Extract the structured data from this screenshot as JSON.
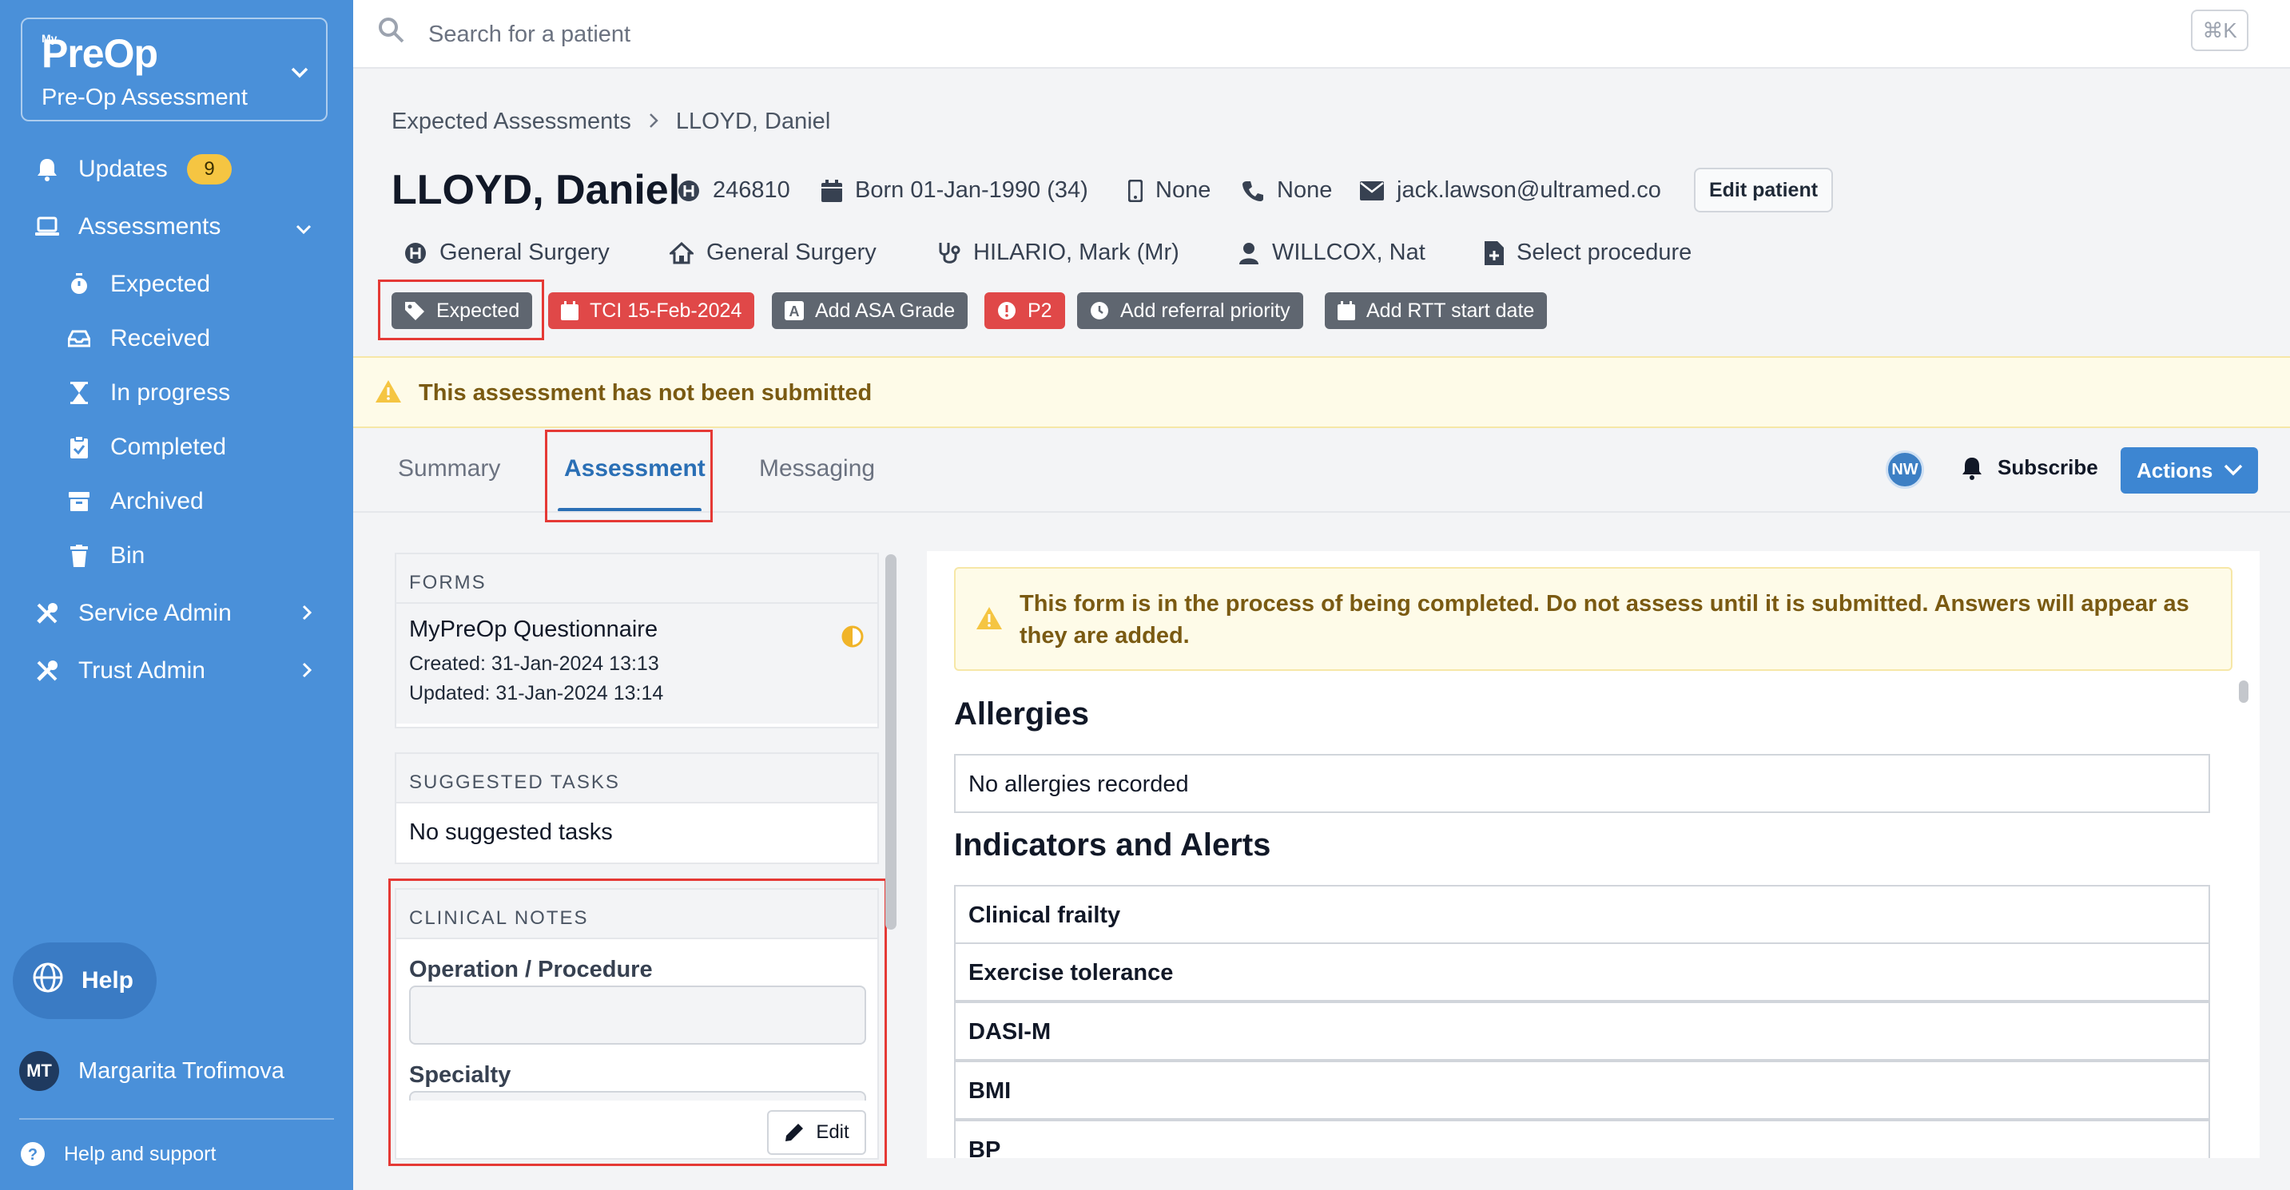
{
  "app": {
    "logo_sup": "My",
    "logo": "PreOp",
    "module": "Pre-Op Assessment"
  },
  "sidebar": {
    "updates_label": "Updates",
    "updates_count": "9",
    "assessments_label": "Assessments",
    "sub_items": [
      "Expected",
      "Received",
      "In progress",
      "Completed",
      "Archived",
      "Bin"
    ],
    "service_admin": "Service Admin",
    "trust_admin": "Trust Admin",
    "help": "Help",
    "user_initials": "MT",
    "user_name": "Margarita Trofimova",
    "support": "Help and support"
  },
  "search": {
    "placeholder": "Search for a patient",
    "shortcut": "⌘K"
  },
  "breadcrumb": {
    "parent": "Expected Assessments",
    "current": "LLOYD, Daniel"
  },
  "patient": {
    "name": "LLOYD, Daniel",
    "hospital_number": "246810",
    "born": "Born 01-Jan-1990 (34)",
    "mobile": "None",
    "phone": "None",
    "email": "jack.lawson@ultramed.co",
    "edit_label": "Edit patient",
    "specialty": "General Surgery",
    "department": "General Surgery",
    "consultant": "HILARIO, Mark (Mr)",
    "assignee": "WILLCOX, Nat",
    "procedure": "Select procedure"
  },
  "tags": {
    "status": "Expected",
    "tci": "TCI 15-Feb-2024",
    "asa": "Add ASA Grade",
    "priority": "P2",
    "referral": "Add referral priority",
    "rtt": "Add RTT start date"
  },
  "banner": {
    "text": "This assessment has not been submitted"
  },
  "tabs": {
    "summary": "Summary",
    "assessment": "Assessment",
    "messaging": "Messaging",
    "avatar": "NW",
    "subscribe": "Subscribe",
    "actions": "Actions"
  },
  "forms": {
    "header": "FORMS",
    "title": "MyPreOp Questionnaire",
    "created": "Created: 31-Jan-2024 13:13",
    "updated": "Updated: 31-Jan-2024 13:14"
  },
  "tasks": {
    "header": "SUGGESTED TASKS",
    "empty": "No suggested tasks"
  },
  "notes": {
    "header": "CLINICAL NOTES",
    "operation_label": "Operation / Procedure",
    "specialty_label": "Specialty",
    "edit": "Edit"
  },
  "form_view": {
    "warning": "This form is in the process of being completed. Do not assess until it is submitted. Answers will appear as they are added.",
    "allergies_title": "Allergies",
    "allergies_value": "No allergies recorded",
    "indicators_title": "Indicators and Alerts",
    "indicators": [
      "Clinical frailty",
      "Exercise tolerance",
      "DASI-M",
      "BMI",
      "BP"
    ]
  },
  "colors": {
    "sidebar": "#4a90d9",
    "accent": "#2a6fb5",
    "danger": "#e04848",
    "warning_bg": "#fefbe8",
    "highlight": "#e53935"
  }
}
